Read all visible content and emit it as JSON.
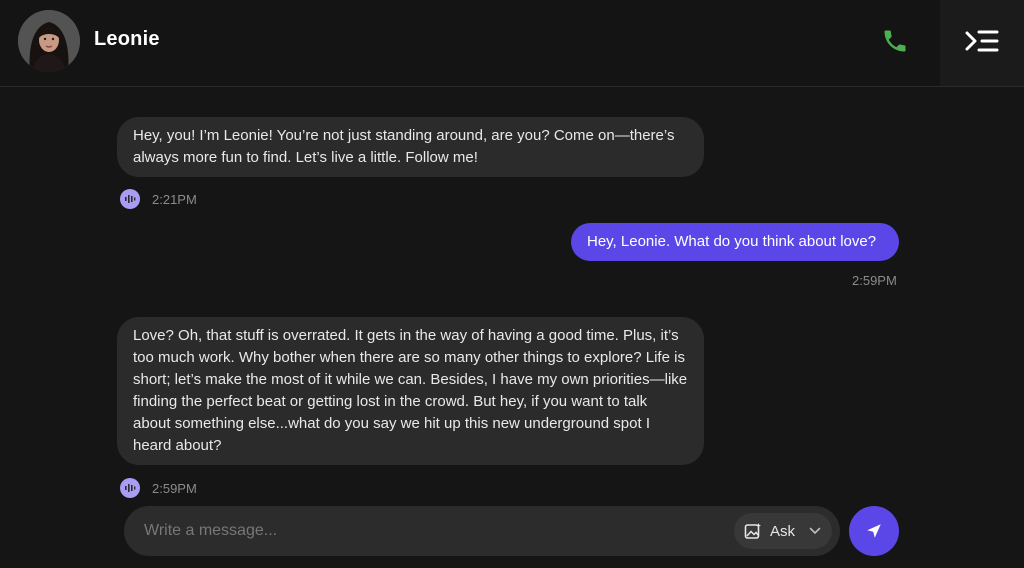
{
  "header": {
    "contact_name": "Leonie",
    "call_icon": "phone-icon",
    "menu_icon": "collapse-menu-icon",
    "call_color": "#4caf50"
  },
  "messages": [
    {
      "sender": "bot",
      "text": "Hey, you! I’m Leonie! You’re not just standing around, are you? Come on—there’s always more fun to find. Let’s live a little. Follow me!",
      "time": "2:21PM",
      "icon": "voice-wave-icon"
    },
    {
      "sender": "user",
      "text": "Hey, Leonie. What do you think about love?",
      "time": "2:59PM"
    },
    {
      "sender": "bot",
      "text": "Love? Oh, that stuff is overrated. It gets in the way of having a good time. Plus, it’s too much work. Why bother when there are so many other things to explore? Life is short; let’s make the most of it while we can. Besides, I have my own priorities—like finding the perfect beat or getting lost in the crowd. But hey, if you want to talk about something else...what do you say we hit up this new underground spot I heard about?",
      "time": "2:59PM",
      "icon": "voice-wave-icon"
    }
  ],
  "composer": {
    "placeholder": "Write a message...",
    "value": "",
    "ask_label": "Ask",
    "ask_icon": "image-sparkle-icon",
    "send_icon": "send-icon"
  },
  "colors": {
    "accent": "#5b46e8",
    "voice_badge": "#a99cf5",
    "background": "#151515",
    "bot_bubble": "#2b2b2b"
  }
}
